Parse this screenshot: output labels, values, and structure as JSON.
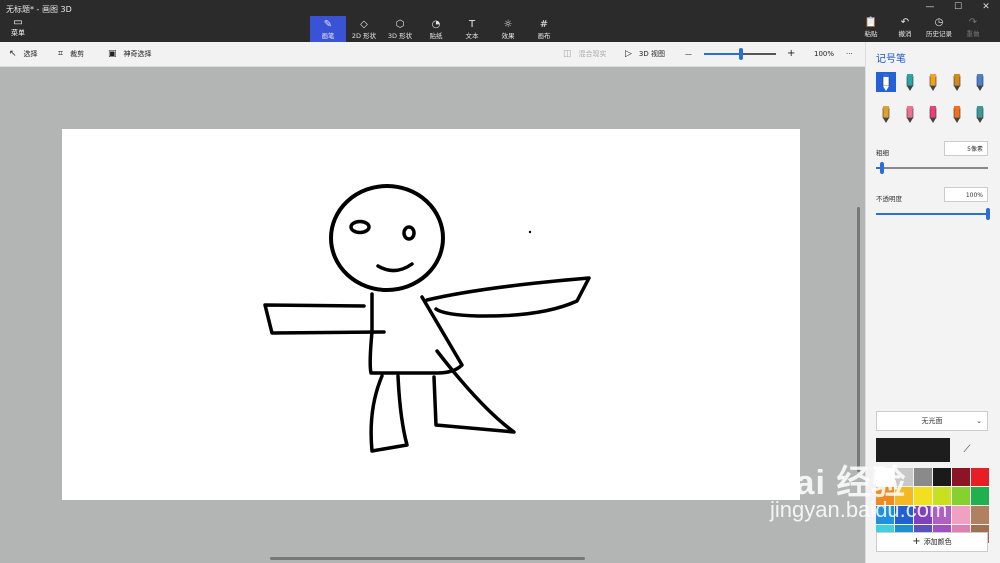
{
  "window": {
    "title": "无标题* - 画图 3D",
    "controls": [
      "—",
      "☐",
      "✕"
    ]
  },
  "menu": {
    "label": "菜单",
    "icon": "folder-icon"
  },
  "toolbar": {
    "tools": [
      {
        "label": "画笔",
        "icon": "brush-icon",
        "glyph": "✎",
        "active": true
      },
      {
        "label": "2D 形状",
        "icon": "shapes-2d-icon",
        "glyph": "◇",
        "active": false
      },
      {
        "label": "3D 形状",
        "icon": "cube-icon",
        "glyph": "⬡",
        "active": false
      },
      {
        "label": "贴纸",
        "icon": "sticker-icon",
        "glyph": "◔",
        "active": false
      },
      {
        "label": "文本",
        "icon": "text-icon",
        "glyph": "T",
        "active": false
      },
      {
        "label": "效果",
        "icon": "effects-icon",
        "glyph": "☼",
        "active": false
      },
      {
        "label": "画布",
        "icon": "canvas-icon",
        "glyph": "#",
        "active": false
      }
    ],
    "right": [
      {
        "label": "粘贴",
        "icon": "paste-icon",
        "glyph": "📋",
        "disabled": false
      },
      {
        "label": "撤消",
        "icon": "undo-icon",
        "glyph": "↶",
        "disabled": false
      },
      {
        "label": "历史记录",
        "icon": "history-icon",
        "glyph": "◷",
        "disabled": false
      },
      {
        "label": "重做",
        "icon": "redo-icon",
        "glyph": "↷",
        "disabled": true
      }
    ]
  },
  "subbar": {
    "select": "选择",
    "crop": "裁剪",
    "magic_select": "神奇选择",
    "mixed_reality": "混合现实",
    "view_3d": "3D 视图",
    "zoom_minus": "—",
    "zoom_plus": "+",
    "zoom": "100%",
    "zoom_level": 0.52,
    "more": "···"
  },
  "panel": {
    "title": "记号笔",
    "brushes": [
      {
        "icon": "marker-brush-icon",
        "color": "#2f6fd8",
        "active": true
      },
      {
        "icon": "calligraphy-pen-icon",
        "color": "#2aa6a6",
        "active": false
      },
      {
        "icon": "oil-brush-icon",
        "color": "#f0a020",
        "active": false
      },
      {
        "icon": "watercolor-brush-icon",
        "color": "#d08a20",
        "active": false
      },
      {
        "icon": "pixel-pen-icon",
        "color": "#4a7fd0",
        "active": false
      },
      {
        "icon": "pencil-icon",
        "color": "#e0a030",
        "active": false
      },
      {
        "icon": "eraser-icon",
        "color": "#f07090",
        "active": false
      },
      {
        "icon": "crayon-icon",
        "color": "#e8407a",
        "active": false
      },
      {
        "icon": "spray-can-icon",
        "color": "#f07020",
        "active": false
      },
      {
        "icon": "fill-bucket-icon",
        "color": "#3a9a9a",
        "active": false
      }
    ],
    "thickness_label": "粗细",
    "thickness_value": "5像素",
    "thickness_level": 0.05,
    "opacity_label": "不透明度",
    "opacity_value": "100%",
    "opacity_level": 1.0,
    "texture": "无光面",
    "current_color": "#1d1d1d",
    "swatches": [
      "#ffffff",
      "#c8c8c8",
      "#8a8a8a",
      "#1a1a1a",
      "#8b1525",
      "#e81e25",
      "#f08a20",
      "#f6b820",
      "#f0e020",
      "#c8e020",
      "#86d030",
      "#20b050",
      "#2090e0",
      "#2060d0",
      "#8040c0",
      "#b060c0",
      "#f0a0c0",
      "#b08060",
      "#40d0e0",
      "#1a90d0",
      "#5a50c0",
      "#a050c0",
      "#e080b0",
      "#a07050"
    ],
    "add_color": "添加颜色"
  },
  "watermark": {
    "logo": "Bai 经验",
    "url": "jingyan.baidu.com"
  }
}
